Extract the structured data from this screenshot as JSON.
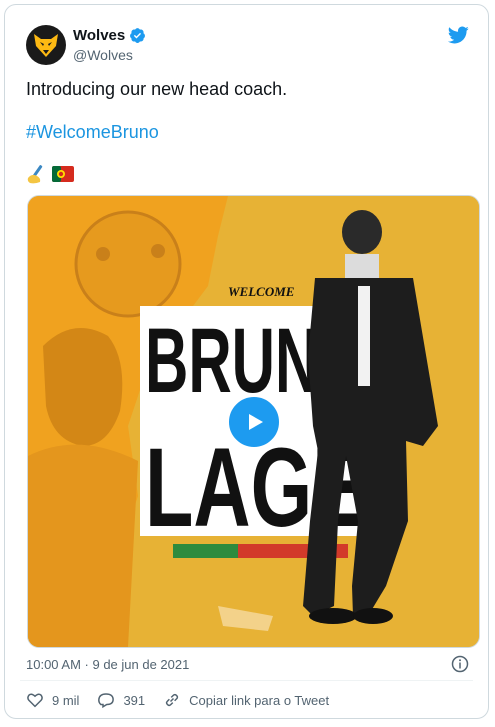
{
  "account": {
    "name": "Wolves",
    "handle": "@Wolves"
  },
  "tweet": {
    "text": "Introducing our new head coach.",
    "hashtag": "#WelcomeBruno",
    "emojis": [
      "writing-hand",
      "portugal-flag"
    ],
    "media": {
      "welcome": "WELCOME",
      "first": "BRUNO",
      "last": "LAGE"
    },
    "timestamp": "10:00 AM · 9 de jun de 2021"
  },
  "actions": {
    "likes": "9 mil",
    "replies": "391",
    "copy_link": "Copiar link para o Tweet"
  },
  "colors": {
    "twitter_blue": "#1d9bf0",
    "hashtag": "#1b95e0",
    "wolves_gold": "#fdb913",
    "poster_yellow": "#e7b235"
  }
}
